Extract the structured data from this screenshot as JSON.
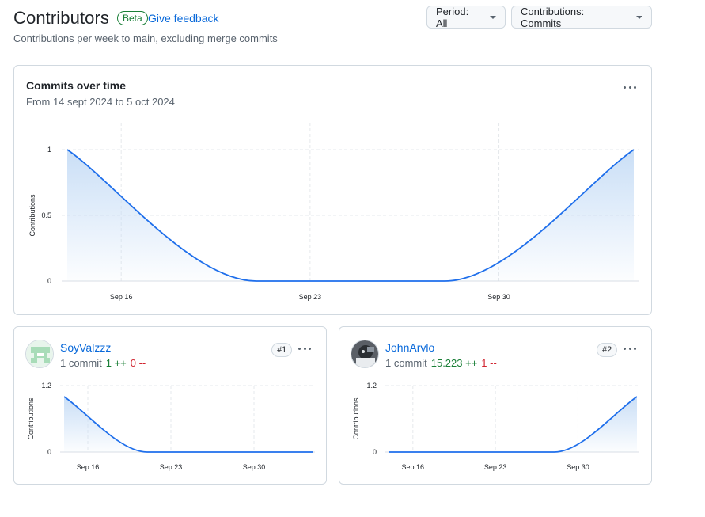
{
  "header": {
    "title": "Contributors",
    "beta_label": "Beta",
    "feedback_label": "Give feedback",
    "subtitle": "Contributions per week to main, excluding merge commits"
  },
  "controls": {
    "period_label": "Period: All",
    "contributions_label": "Contributions: Commits"
  },
  "main_chart": {
    "title": "Commits over time",
    "range_text": "From 14 sept 2024 to 5 oct 2024"
  },
  "contributors": [
    {
      "name": "SoyValzzz",
      "rank": "#1",
      "commits": "1 commit",
      "additions": "1 ++",
      "deletions": "0 --"
    },
    {
      "name": "JohnArvlo",
      "rank": "#2",
      "commits": "1 commit",
      "additions": "15.223 ++",
      "deletions": "1 --"
    }
  ],
  "colors": {
    "line": "#1f6feb",
    "fill_top": "#c7ddf6",
    "link": "#0969da",
    "addition": "#1a7f37",
    "deletion": "#d1242f"
  },
  "icons": {
    "kebab": "kebab-horizontal-icon",
    "caret": "triangle-down-icon"
  },
  "chart_data": [
    {
      "type": "area",
      "ylabel": "Contributions",
      "x_ticks": [
        "Sep 16",
        "Sep 23",
        "Sep 30"
      ],
      "y_ticks": [
        "0",
        "0.5",
        "1"
      ],
      "ylim": [
        0,
        1
      ],
      "x": [
        "2024-09-14",
        "2024-09-21",
        "2024-09-28",
        "2024-10-05"
      ],
      "values": [
        1,
        0,
        0,
        1
      ],
      "smooth": true
    },
    {
      "type": "area",
      "ylabel": "Contributions",
      "x_ticks": [
        "Sep 16",
        "Sep 23",
        "Sep 30"
      ],
      "y_ticks": [
        "0",
        "1.2"
      ],
      "ylim": [
        0,
        1.2
      ],
      "x": [
        "2024-09-14",
        "2024-09-21",
        "2024-09-28",
        "2024-10-05"
      ],
      "values": [
        1,
        0,
        0,
        0
      ],
      "smooth": true
    },
    {
      "type": "area",
      "ylabel": "Contributions",
      "x_ticks": [
        "Sep 16",
        "Sep 23",
        "Sep 30"
      ],
      "y_ticks": [
        "0",
        "1.2"
      ],
      "ylim": [
        0,
        1.2
      ],
      "x": [
        "2024-09-14",
        "2024-09-21",
        "2024-09-28",
        "2024-10-05"
      ],
      "values": [
        0,
        0,
        0,
        1
      ],
      "smooth": true
    }
  ]
}
